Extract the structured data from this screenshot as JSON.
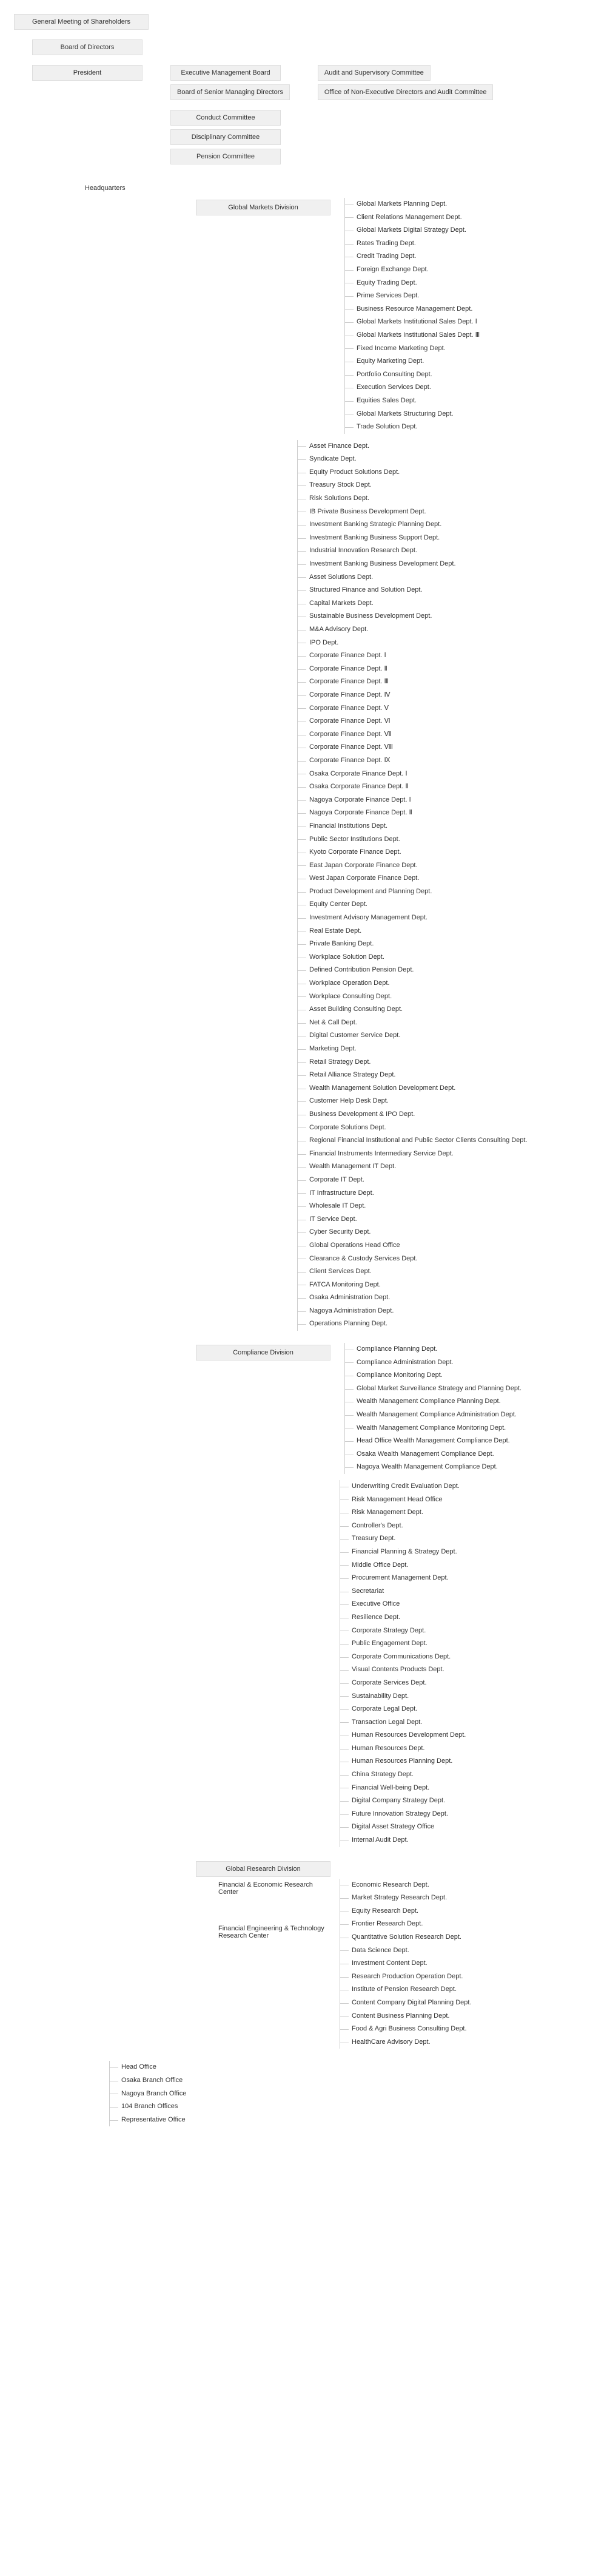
{
  "top": {
    "gm": "General Meeting of Shareholders",
    "bod": "Board of Directors",
    "president": "President",
    "emb": "Executive Management Board",
    "bsmd": "Board of Senior Managing Directors",
    "asc": "Audit and Supervisory Committee",
    "oned": "Office of Non-Executive Directors and Audit Committee",
    "cc": "Conduct Committee",
    "dc": "Disciplinary Committee",
    "pc": "Pension Committee"
  },
  "hq": "Headquarters",
  "gmd": {
    "title": "Global Markets Division",
    "depts": [
      "Global Markets Planning Dept.",
      "Client Relations Management Dept.",
      "Global Markets Digital Strategy Dept.",
      "Rates Trading Dept.",
      "Credit Trading Dept.",
      "Foreign Exchange Dept.",
      "Equity Trading Dept.",
      "Prime Services Dept.",
      "Business Resource Management Dept.",
      "Global Markets Institutional Sales Dept. Ⅰ",
      "Global Markets Institutional Sales Dept. Ⅲ",
      "Fixed Income Marketing Dept.",
      "Equity Marketing Dept.",
      "Portfolio Consulting Dept.",
      "Execution Services Dept.",
      "Equities Sales Dept.",
      "Global Markets Structuring Dept.",
      "Trade Solution Dept."
    ]
  },
  "block2": [
    "Asset Finance Dept.",
    "Syndicate Dept.",
    "Equity Product Solutions Dept.",
    "Treasury Stock Dept.",
    "Risk Solutions Dept.",
    "IB Private Business Development Dept.",
    "Investment Banking Strategic Planning Dept.",
    "Investment Banking Business Support Dept.",
    "Industrial Innovation Research Dept.",
    "Investment Banking Business Development Dept.",
    "Asset Solutions Dept.",
    "Structured Finance and Solution Dept.",
    "Capital Markets Dept.",
    "Sustainable Business Development Dept.",
    "M&A Advisory Dept.",
    "IPO Dept.",
    "Corporate Finance Dept. Ⅰ",
    "Corporate Finance Dept. Ⅱ",
    "Corporate Finance Dept. Ⅲ",
    "Corporate Finance Dept. Ⅳ",
    "Corporate Finance Dept. Ⅴ",
    "Corporate Finance Dept. Ⅵ",
    "Corporate Finance Dept. Ⅶ",
    "Corporate Finance Dept. Ⅷ",
    "Corporate Finance Dept. Ⅸ",
    "Osaka Corporate Finance Dept. Ⅰ",
    "Osaka Corporate Finance Dept. Ⅱ",
    "Nagoya Corporate Finance Dept. Ⅰ",
    "Nagoya Corporate Finance Dept. Ⅱ",
    "Financial Institutions Dept.",
    "Public Sector Institutions Dept.",
    "Kyoto Corporate Finance Dept.",
    "East Japan Corporate Finance Dept.",
    "West Japan Corporate Finance Dept.",
    "Product Development and Planning Dept.",
    "Equity Center Dept.",
    "Investment Advisory Management Dept.",
    "Real Estate Dept.",
    "Private Banking Dept.",
    "Workplace Solution Dept.",
    "Defined Contribution Pension Dept.",
    "Workplace Operation Dept.",
    "Workplace Consulting Dept.",
    "Asset Building Consulting Dept.",
    "Net & Call Dept.",
    "Digital Customer Service Dept.",
    "Marketing Dept.",
    "Retail Strategy Dept.",
    "Retail Alliance Strategy Dept.",
    "Wealth Management Solution Development Dept.",
    "Customer Help Desk Dept.",
    "Business Development & IPO Dept.",
    "Corporate Solutions Dept.",
    "Regional Financial Institutional and Public Sector Clients Consulting Dept.",
    "Financial Instruments Intermediary Service Dept.",
    "Wealth Management IT Dept.",
    "Corporate IT Dept.",
    "IT Infrastructure Dept.",
    "Wholesale IT Dept.",
    "IT Service Dept.",
    "Cyber Security Dept.",
    "Global Operations Head Office",
    "Clearance & Custody Services Dept.",
    "Client Services Dept.",
    "FATCA Monitoring Dept.",
    "Osaka Administration Dept.",
    "Nagoya Administration Dept.",
    "Operations Planning Dept."
  ],
  "cd": {
    "title": "Compliance Division",
    "depts": [
      "Compliance Planning Dept.",
      "Compliance Administration Dept.",
      "Compliance Monitoring Dept.",
      "Global Market Surveillance Strategy and Planning Dept.",
      "Wealth Management Compliance Planning Dept.",
      "Wealth Management Compliance Administration Dept.",
      "Wealth Management Compliance Monitoring Dept.",
      "Head Office Wealth Management Compliance Dept.",
      "Osaka Wealth Management Compliance Dept.",
      "Nagoya Wealth Management Compliance Dept."
    ]
  },
  "block3": [
    "Underwriting Credit Evaluation Dept.",
    "Risk Management Head Office",
    "Risk Management Dept.",
    "Controller's Dept.",
    "Treasury Dept.",
    "Financial Planning & Strategy Dept.",
    "Middle Office Dept.",
    "Procurement Management Dept.",
    "Secretariat",
    "Executive Office",
    "Resilience Dept.",
    "Corporate Strategy Dept.",
    "Public Engagement Dept.",
    "Corporate Communications Dept.",
    "Visual Contents Products Dept.",
    "Corporate Services Dept.",
    "Sustainability Dept.",
    "Corporate Legal Dept.",
    "Transaction Legal Dept.",
    "Human Resources Development Dept.",
    "Human Resources Dept.",
    "Human Resources Planning Dept.",
    "China Strategy Dept.",
    "Financial Well-being Dept.",
    "Digital Company Strategy Dept.",
    "Future Innovation Strategy Dept.",
    "Digital Asset Strategy Office",
    "Internal Audit Dept."
  ],
  "grd": {
    "title": "Global Research Division",
    "centers": {
      "ferc": "Financial & Economic Research Center",
      "fetrc": "Financial Engineering & Technology Research Center"
    },
    "depts": [
      "Economic Research Dept.",
      "Market Strategy Research Dept.",
      "Equity Research Dept.",
      "Frontier Research Dept.",
      "Quantitative Solution Research Dept.",
      "Data Science Dept.",
      "Investment Content Dept.",
      "Research Production Operation Dept.",
      "Institute of Pension Research Dept.",
      "Content Company Digital Planning Dept.",
      "Content Business Planning Dept.",
      "Food & Agri Business Consulting Dept.",
      "HealthCare Advisory Dept."
    ]
  },
  "bottom": [
    "Head Office",
    "Osaka Branch Office",
    "Nagoya Branch Office",
    "104 Branch Offices",
    "Representative Office"
  ]
}
